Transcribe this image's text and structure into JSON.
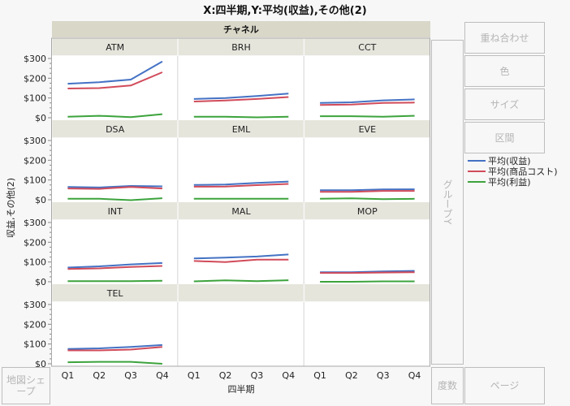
{
  "title": "X:四半期,Y:平均(収益),その他(2)",
  "buttons": {
    "overlay": "重ね合わせ",
    "color": "色",
    "size": "サイズ",
    "interval": "区間",
    "group_y": "グループY",
    "map_shape": "地図シェープ",
    "freq": "度数",
    "page": "ページ"
  },
  "legend": [
    {
      "label": "平均(収益)",
      "color": "#4472c4"
    },
    {
      "label": "平均(商品コスト)",
      "color": "#d14b5a"
    },
    {
      "label": "平均(利益)",
      "color": "#3ca33c"
    }
  ],
  "chart_data": {
    "type": "line",
    "title": "X:四半期,Y:平均(収益),その他(2)",
    "facet_header": "チャネル",
    "xlabel": "四半期",
    "ylabel": "収益,その他(2)",
    "x": [
      "Q1",
      "Q2",
      "Q3",
      "Q4"
    ],
    "ylim": [
      0,
      300
    ],
    "yticks": [
      "$0",
      "$100",
      "$200",
      "$300"
    ],
    "ytick_values": [
      0,
      100,
      200,
      300
    ],
    "series_names": [
      "平均(収益)",
      "平均(商品コスト)",
      "平均(利益)"
    ],
    "series_colors": [
      "#4472c4",
      "#d14b5a",
      "#3ca33c"
    ],
    "panels": [
      {
        "name": "ATM",
        "series": [
          [
            172,
            180,
            193,
            285
          ],
          [
            148,
            150,
            163,
            230
          ],
          [
            5,
            10,
            3,
            18
          ]
        ]
      },
      {
        "name": "BRH",
        "series": [
          [
            95,
            100,
            110,
            122
          ],
          [
            82,
            87,
            95,
            105
          ],
          [
            5,
            5,
            2,
            5
          ]
        ]
      },
      {
        "name": "CCT",
        "series": [
          [
            75,
            78,
            88,
            93
          ],
          [
            65,
            67,
            75,
            77
          ],
          [
            8,
            8,
            5,
            10
          ]
        ]
      },
      {
        "name": "DSA",
        "series": [
          [
            65,
            62,
            70,
            68
          ],
          [
            57,
            55,
            65,
            57
          ],
          [
            5,
            5,
            -2,
            8
          ]
        ]
      },
      {
        "name": "EML",
        "series": [
          [
            75,
            77,
            85,
            92
          ],
          [
            66,
            67,
            74,
            80
          ],
          [
            5,
            5,
            5,
            5
          ]
        ]
      },
      {
        "name": "EVE",
        "series": [
          [
            48,
            48,
            52,
            53
          ],
          [
            40,
            40,
            45,
            45
          ],
          [
            5,
            7,
            3,
            5
          ]
        ]
      },
      {
        "name": "INT",
        "series": [
          [
            72,
            78,
            88,
            95
          ],
          [
            65,
            68,
            75,
            80
          ],
          [
            3,
            3,
            3,
            5
          ]
        ]
      },
      {
        "name": "MAL",
        "series": [
          [
            118,
            122,
            128,
            138
          ],
          [
            105,
            100,
            112,
            112
          ],
          [
            2,
            7,
            3,
            8
          ]
        ]
      },
      {
        "name": "MOP",
        "series": [
          [
            48,
            48,
            52,
            55
          ],
          [
            45,
            45,
            47,
            48
          ],
          [
            0,
            0,
            2,
            2
          ]
        ]
      },
      {
        "name": "TEL",
        "series": [
          [
            75,
            78,
            85,
            95
          ],
          [
            68,
            68,
            72,
            85
          ],
          [
            8,
            10,
            10,
            0
          ]
        ]
      }
    ]
  }
}
